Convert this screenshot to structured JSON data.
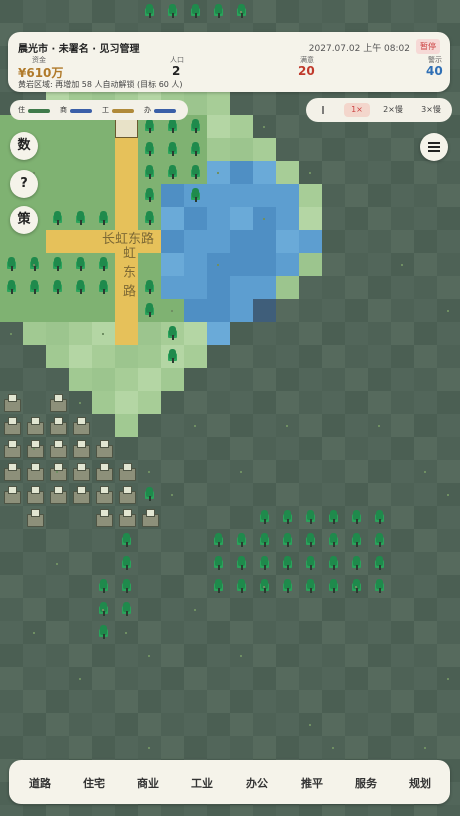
{
  "header": {
    "breadcrumb": "晨光市 · 未署名 · 见习管理",
    "timestamp": "2027.07.02 上午 08:02",
    "pause_badge": "暂停"
  },
  "stats": {
    "funds": {
      "label": "资金",
      "value": "¥610万",
      "color": "#b07a2a"
    },
    "population": {
      "label": "人口",
      "value": "2",
      "color": "#222222"
    },
    "satisfaction": {
      "label": "满意",
      "value": "20",
      "color": "#c0392b"
    },
    "alert": {
      "label": "警示",
      "value": "40",
      "color": "#2f6fb5"
    }
  },
  "status_note": "黄岩区域: 再增加 58 人自动解锁 (目标 60 人)",
  "zone_legend": [
    {
      "label": "住",
      "color": "#3f7a4a"
    },
    {
      "label": "商",
      "color": "#3a5fa8"
    },
    {
      "label": "工",
      "color": "#b08a3a"
    },
    {
      "label": "办",
      "color": "#3a5fa8"
    }
  ],
  "speed": {
    "options": [
      "‖",
      "1×",
      "2×慢",
      "3×慢"
    ],
    "selected": 1
  },
  "side_buttons": {
    "data": "数",
    "help": "?",
    "policy": "策"
  },
  "road_names": {
    "horizontal": "长虹东路",
    "vertical": "虹东路"
  },
  "toolbar": [
    "道路",
    "住宅",
    "商业",
    "工业",
    "办公",
    "推平",
    "服务",
    "规划"
  ]
}
